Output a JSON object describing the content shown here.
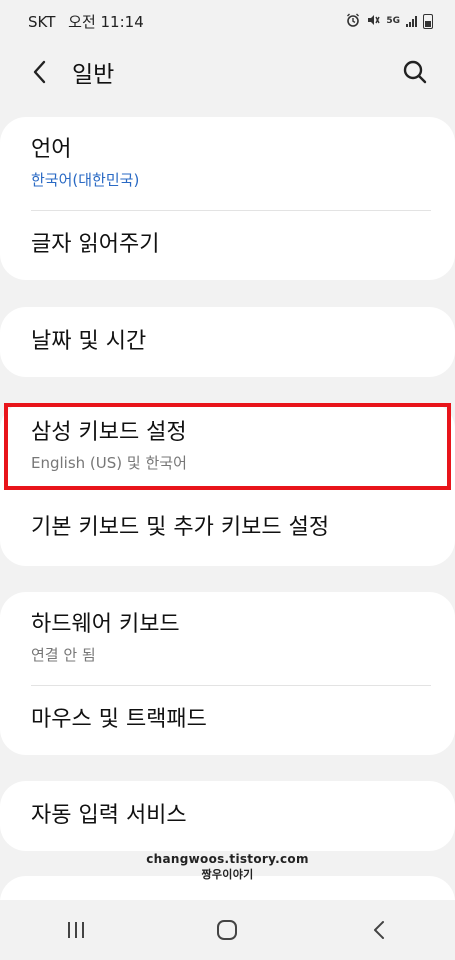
{
  "status_bar": {
    "carrier": "SKT",
    "time": "오전 11:14",
    "network": "5G"
  },
  "header": {
    "title": "일반"
  },
  "groups": [
    {
      "items": [
        {
          "label": "언어",
          "sub": "한국어(대한민국)"
        },
        {
          "label": "글자 읽어주기"
        }
      ]
    },
    {
      "items": [
        {
          "label": "날짜 및 시간"
        }
      ]
    },
    {
      "items": [
        {
          "label": "삼성 키보드 설정",
          "sub": "English (US) 및 한국어"
        },
        {
          "label": "기본 키보드 및 추가 키보드 설정"
        }
      ]
    },
    {
      "items": [
        {
          "label": "하드웨어 키보드",
          "sub": "연결 안 됨"
        },
        {
          "label": "마우스 및 트랙패드"
        }
      ]
    },
    {
      "items": [
        {
          "label": "자동 입력 서비스"
        }
      ]
    }
  ],
  "watermark": {
    "line1": "changwoos.tistory.com",
    "line2": "짱우이야기"
  },
  "colors": {
    "background": "#f2f2f2",
    "card": "#ffffff",
    "accent_blue": "#2a6ac4",
    "highlight_red": "#e8141a"
  },
  "icons": {
    "back": "chevron-left-icon",
    "search": "search-icon",
    "nav_recents": "recents-icon",
    "nav_home": "home-icon",
    "nav_back": "back-icon"
  }
}
